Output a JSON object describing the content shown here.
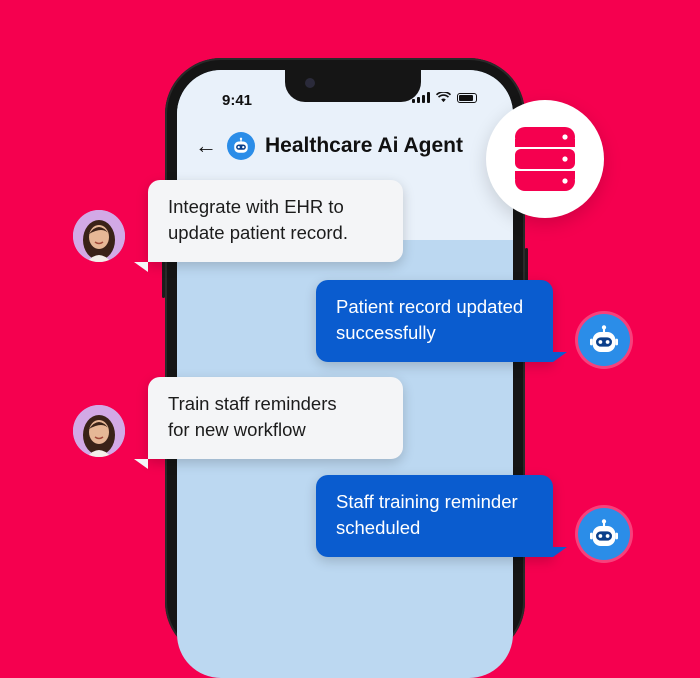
{
  "status_bar": {
    "time": "9:41"
  },
  "header": {
    "title": "Healthcare Ai Agent",
    "back_icon": "arrow-left-icon",
    "bot_icon": "robot-icon"
  },
  "badge": {
    "icon": "database-icon",
    "color": "#f5004f"
  },
  "messages": [
    {
      "sender": "user",
      "lines": [
        "Integrate with EHR to",
        "update patient record."
      ]
    },
    {
      "sender": "bot",
      "lines": [
        "Patient record updated",
        "successfully"
      ]
    },
    {
      "sender": "user",
      "lines": [
        "Train staff reminders",
        "for new workflow"
      ]
    },
    {
      "sender": "bot",
      "lines": [
        "Staff training reminder",
        "scheduled"
      ]
    }
  ],
  "colors": {
    "background": "#f5004f",
    "bot_bubble": "#0a5ccf",
    "user_bubble": "#f4f5f7",
    "bot_avatar": "#2b8de8"
  }
}
